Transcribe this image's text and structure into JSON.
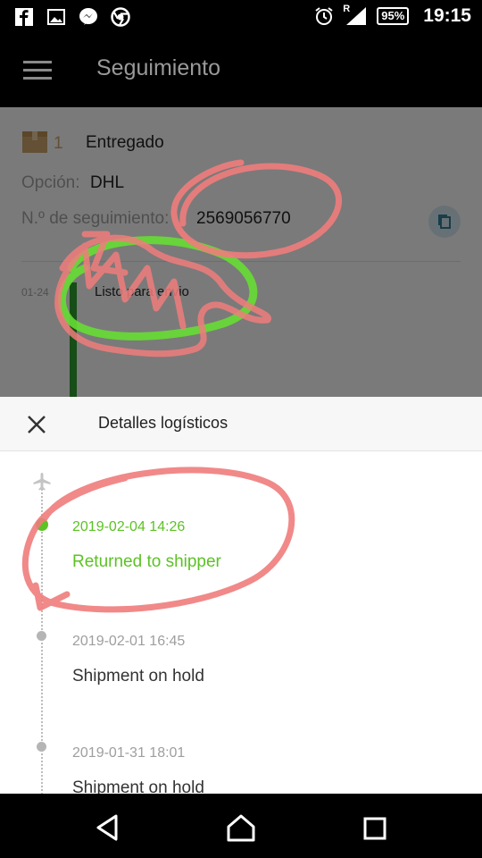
{
  "status_bar": {
    "battery": "95%",
    "time": "19:15",
    "network": "R"
  },
  "app_bar": {
    "title": "Seguimiento"
  },
  "background_card": {
    "package_count": "1",
    "status": "Entregado",
    "option_label": "Opción:",
    "option_value": "DHL",
    "tracking_label": "N.º de seguimiento:",
    "tracking_number": "2569056770",
    "first_event_date": "01-24",
    "first_event_text": "Listo para envio"
  },
  "sheet": {
    "title": "Detalles logísticos",
    "events": [
      {
        "time": "2019-02-04 14:26",
        "status": "Returned to shipper",
        "active": true
      },
      {
        "time": "2019-02-01 16:45",
        "status": "Shipment on hold",
        "active": false
      },
      {
        "time": "2019-01-31 18:01",
        "status": "Shipment on hold",
        "active": false
      }
    ]
  },
  "colors": {
    "active_green": "#5cc225",
    "inactive_gray": "#9e9e9e",
    "annotation_red": "#f07c7c",
    "annotation_green": "#66dd33"
  }
}
